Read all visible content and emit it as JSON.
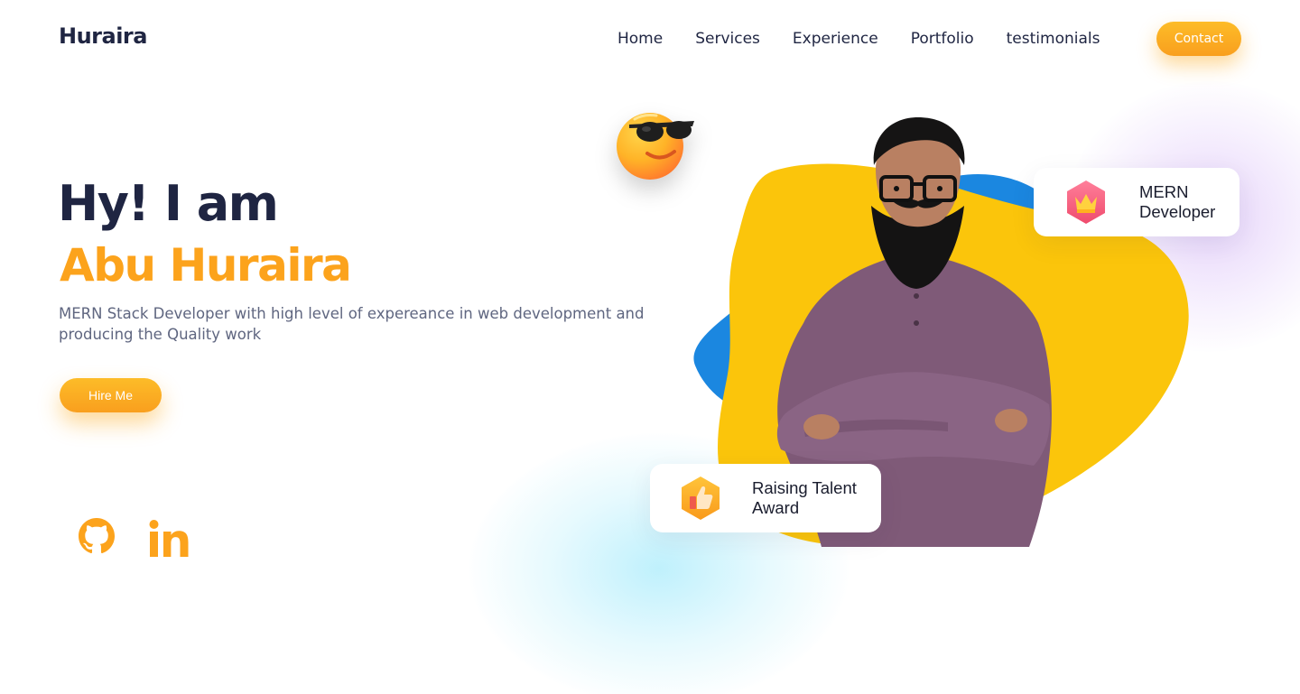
{
  "header": {
    "logo": "Huraira",
    "nav": [
      "Home",
      "Services",
      "Experience",
      "Portfolio",
      "testimonials"
    ],
    "contact_label": "Contact"
  },
  "hero": {
    "greeting": "Hy! I am",
    "name": "Abu Huraira",
    "description_line1": "MERN Stack Developer with high level of expereance in web development and",
    "description_line2": "producing the Quality work",
    "hire_label": "Hire Me"
  },
  "social": {
    "icons": [
      "github-icon",
      "linkedin-icon"
    ]
  },
  "cards": {
    "mern": {
      "line1": "MERN",
      "line2": "Developer",
      "icon": "crown-icon"
    },
    "award": {
      "line1": "Raising Talent",
      "line2": "Award",
      "icon": "thumbs-up-icon"
    }
  },
  "colors": {
    "accent": "#fca31c",
    "dark": "#1f2542",
    "blob_yellow": "#fbc50b",
    "blob_blue": "#1b87e0",
    "shirt": "#7f5a78"
  }
}
